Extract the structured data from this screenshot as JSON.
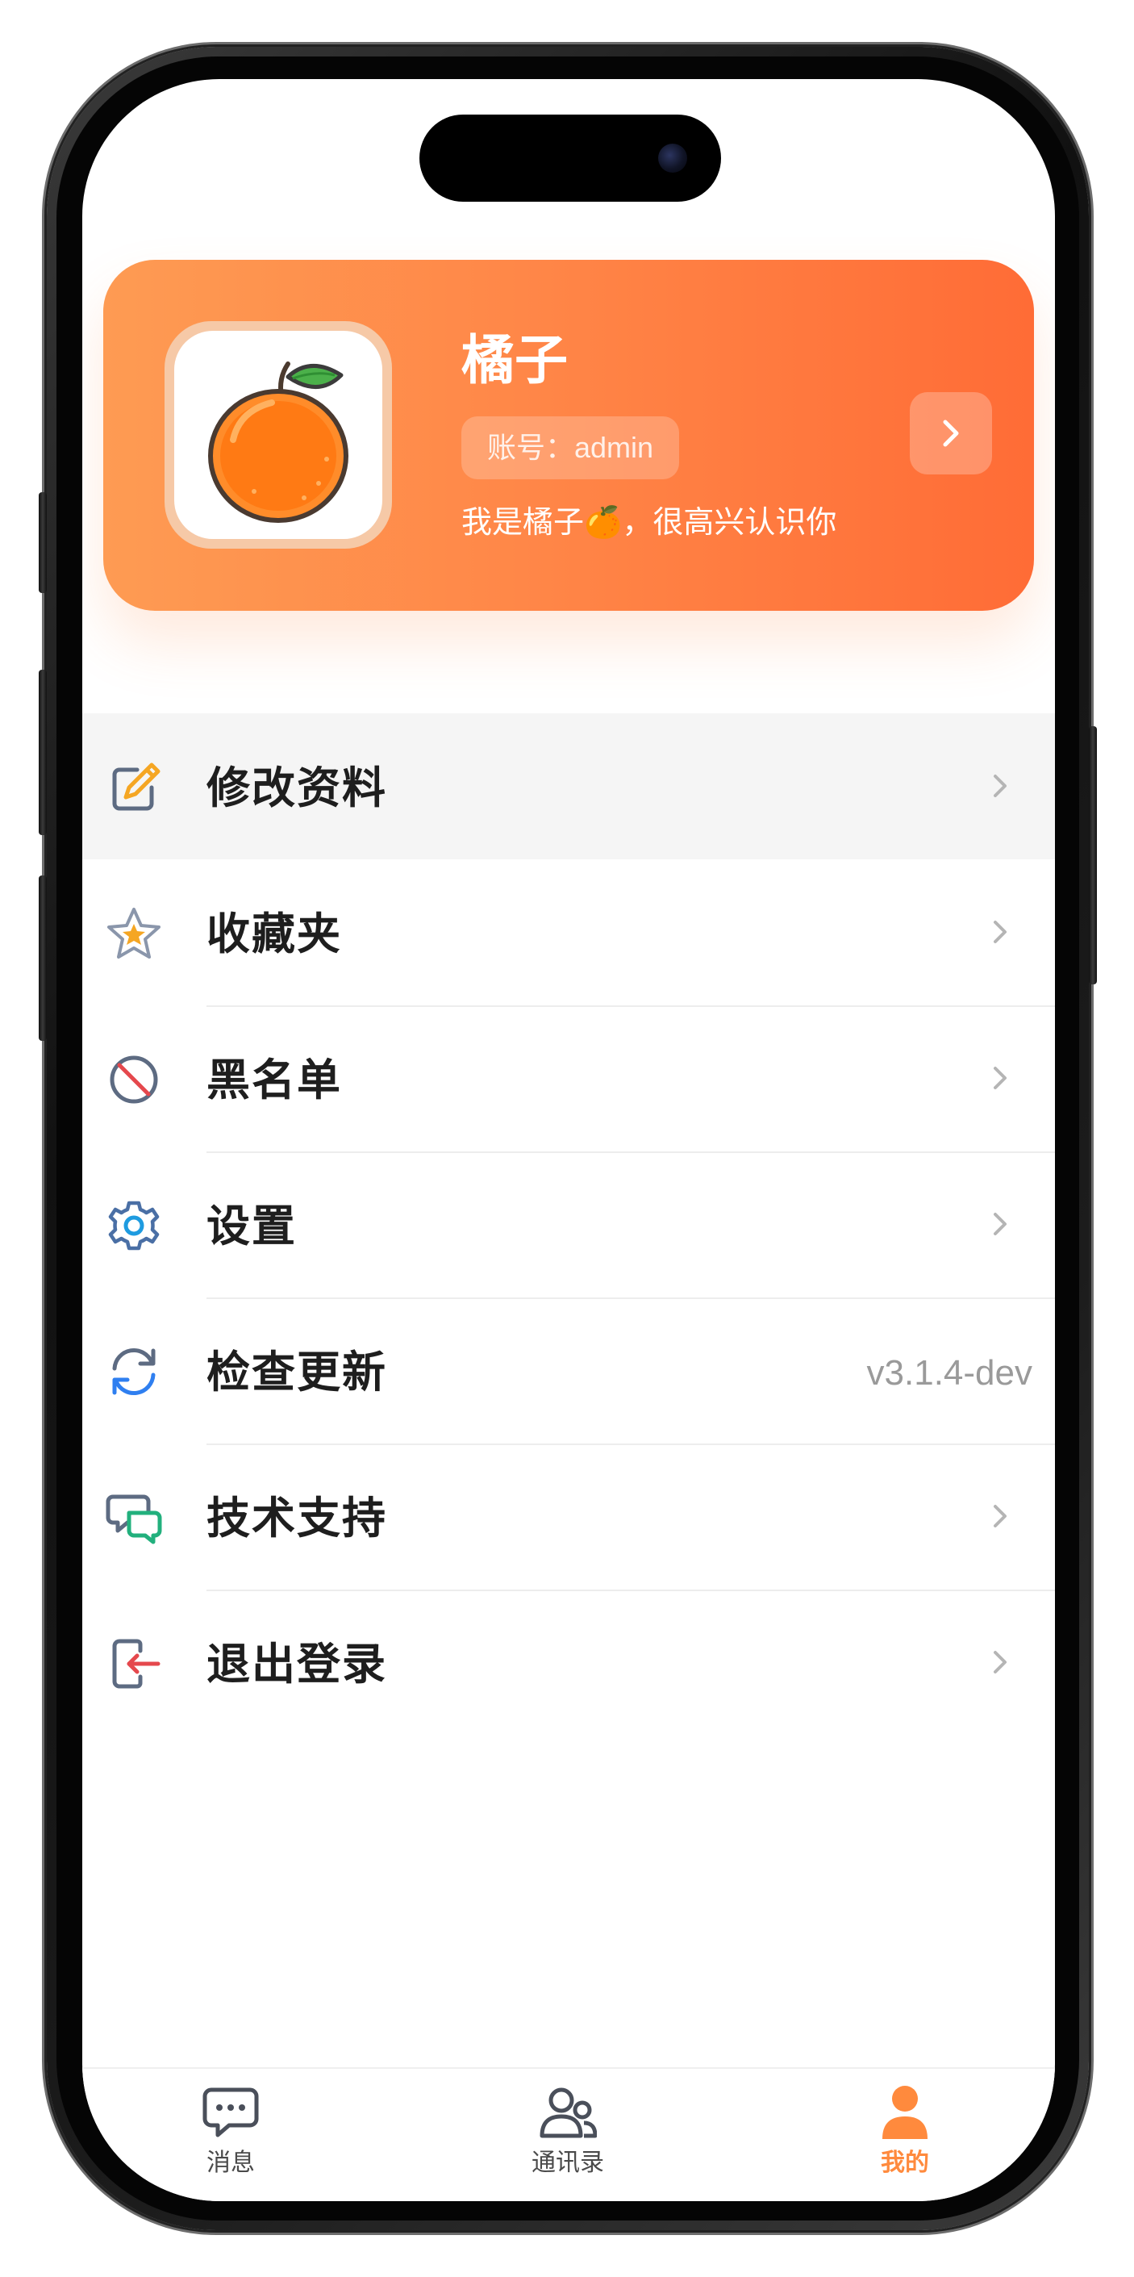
{
  "profile": {
    "name": "橘子",
    "account": "账号：admin",
    "bio": "我是橘子🍊，很高兴认识你"
  },
  "menu": {
    "items": [
      {
        "label": "修改资料",
        "icon": "edit-icon"
      },
      {
        "label": "收藏夹",
        "icon": "star-icon"
      },
      {
        "label": "黑名单",
        "icon": "block-icon"
      },
      {
        "label": "设置",
        "icon": "gear-icon"
      },
      {
        "label": "检查更新",
        "icon": "refresh-icon",
        "value": "v3.1.4-dev"
      },
      {
        "label": "技术支持",
        "icon": "chat-support-icon"
      },
      {
        "label": "退出登录",
        "icon": "logout-icon"
      }
    ]
  },
  "tabbar": {
    "tabs": [
      {
        "label": "消息",
        "icon": "message-icon"
      },
      {
        "label": "通讯录",
        "icon": "contacts-icon"
      },
      {
        "label": "我的",
        "icon": "user-icon",
        "active": true
      }
    ]
  },
  "colors": {
    "accent": "#ff8a3d",
    "card_gradient_start": "#fe9b53",
    "card_gradient_end": "#ff6c36"
  }
}
